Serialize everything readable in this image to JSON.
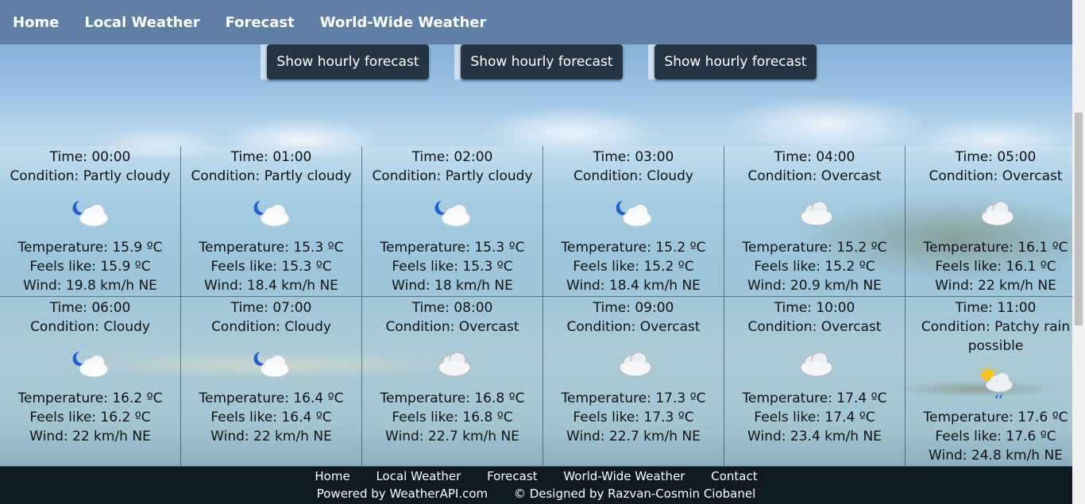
{
  "nav": {
    "home": "Home",
    "local": "Local Weather",
    "forecast": "Forecast",
    "worldwide": "World-Wide Weather"
  },
  "buttons": {
    "hourly_label": "Show hourly forecast"
  },
  "hours": [
    {
      "time": "Time: 00:00",
      "condition": "Condition: Partly cloudy",
      "icon": "moon-cloud-icon",
      "temp": "Temperature: 15.9 ºC",
      "feels": "Feels like: 15.9 ºC",
      "wind": "Wind: 19.8 km/h NE"
    },
    {
      "time": "Time: 01:00",
      "condition": "Condition: Partly cloudy",
      "icon": "moon-cloud-icon",
      "temp": "Temperature: 15.3 ºC",
      "feels": "Feels like: 15.3 ºC",
      "wind": "Wind: 18.4 km/h NE"
    },
    {
      "time": "Time: 02:00",
      "condition": "Condition: Partly cloudy",
      "icon": "moon-cloud-icon",
      "temp": "Temperature: 15.3 ºC",
      "feels": "Feels like: 15.3 ºC",
      "wind": "Wind: 18 km/h NE"
    },
    {
      "time": "Time: 03:00",
      "condition": "Condition: Cloudy",
      "icon": "moon-cloud-icon",
      "temp": "Temperature: 15.2 ºC",
      "feels": "Feels like: 15.2 ºC",
      "wind": "Wind: 18.4 km/h NE"
    },
    {
      "time": "Time: 04:00",
      "condition": "Condition: Overcast",
      "icon": "cloud-icon",
      "temp": "Temperature: 15.2 ºC",
      "feels": "Feels like: 15.2 ºC",
      "wind": "Wind: 20.9 km/h NE"
    },
    {
      "time": "Time: 05:00",
      "condition": "Condition: Overcast",
      "icon": "cloud-icon",
      "temp": "Temperature: 16.1 ºC",
      "feels": "Feels like: 16.1 ºC",
      "wind": "Wind: 22 km/h NE"
    },
    {
      "time": "Time: 06:00",
      "condition": "Condition: Cloudy",
      "icon": "moon-cloud-icon",
      "temp": "Temperature: 16.2 ºC",
      "feels": "Feels like: 16.2 ºC",
      "wind": "Wind: 22 km/h NE"
    },
    {
      "time": "Time: 07:00",
      "condition": "Condition: Cloudy",
      "icon": "moon-cloud-icon",
      "temp": "Temperature: 16.4 ºC",
      "feels": "Feels like: 16.4 ºC",
      "wind": "Wind: 22 km/h NE"
    },
    {
      "time": "Time: 08:00",
      "condition": "Condition: Overcast",
      "icon": "cloud-icon",
      "temp": "Temperature: 16.8 ºC",
      "feels": "Feels like: 16.8 ºC",
      "wind": "Wind: 22.7 km/h NE"
    },
    {
      "time": "Time: 09:00",
      "condition": "Condition: Overcast",
      "icon": "cloud-icon",
      "temp": "Temperature: 17.3 ºC",
      "feels": "Feels like: 17.3 ºC",
      "wind": "Wind: 22.7 km/h NE"
    },
    {
      "time": "Time: 10:00",
      "condition": "Condition: Overcast",
      "icon": "cloud-icon",
      "temp": "Temperature: 17.4 ºC",
      "feels": "Feels like: 17.4 ºC",
      "wind": "Wind: 23.4 km/h NE"
    },
    {
      "time": "Time: 11:00",
      "condition": "Condition: Patchy rain possible",
      "icon": "sun-cloud-rain-icon",
      "temp": "Temperature: 17.6 ºC",
      "feels": "Feels like: 17.6 ºC",
      "wind": "Wind: 24.8 km/h NE"
    }
  ],
  "footer": {
    "home": "Home",
    "local": "Local Weather",
    "forecast": "Forecast",
    "worldwide": "World-Wide Weather",
    "contact": "Contact",
    "powered": "Powered by WeatherAPI.com",
    "designed": "© Designed by Razvan-Cosmin Ciobanel"
  },
  "colors": {
    "nav_bg": "#5f7fa6",
    "button_bg": "#253445",
    "footer_bg": "#0e1a1f"
  }
}
